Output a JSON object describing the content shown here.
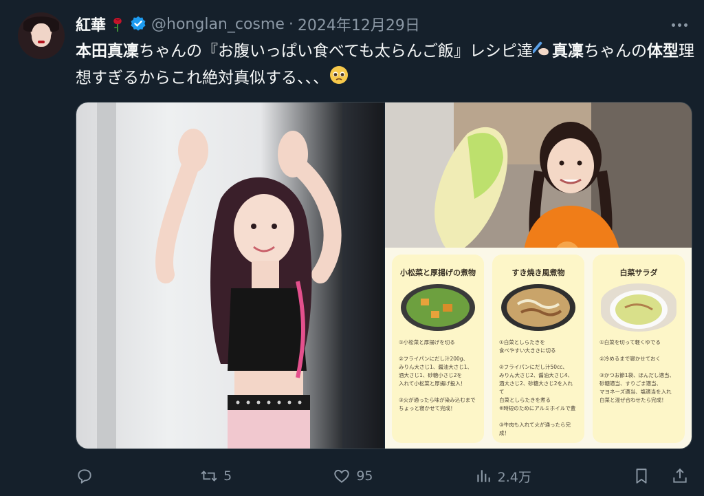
{
  "author": {
    "name": "紅華",
    "handle": "@honglan_cosme",
    "separator": "·",
    "date": "2024年12月29日"
  },
  "tweet": {
    "part1_bold": "本田真凜",
    "part2": "ちゃんの『お腹いっぱい食べても太らんご飯』レシピ達",
    "part3_bold": "真凜",
    "part4": "ちゃんの",
    "part5_bold": "体型",
    "part6": "理想すぎるからこれ絶対真似する、、、"
  },
  "recipes": [
    {
      "title": "小松菜と厚揚げの煮物",
      "steps": "①小松菜と厚揚げを切る\n\n②フライパンにだし汁200g、\nみりん大さじ1、醤油大さじ1、\n酒大さじ1、砂糖小さじ2を\n入れて小松菜と厚揚げ投入！\n\n③火が通ったら味が染み込むまで\nちょっと寝かせて完成！"
    },
    {
      "title": "すき焼き風煮物",
      "steps": "①白菜としらたきを\n食べやすい大きさに切る\n\n②フライパンにだし汁50cc、\nみりん大さじ2、醤油大さじ4、\n酒大さじ2、砂糖大さじ2を入れて\n白菜としらたきを煮る\n※時短のためにアルミホイルで蓋\n\n③牛肉も入れて火が通ったら完成！"
    },
    {
      "title": "白菜サラダ",
      "steps": "①白菜を切って軽くゆでる\n\n②冷めるまで寝かせておく\n\n③かつお節1袋、ほんだし適当、\n砂糖適当、すりごま適当、\nマヨネーズ適当、塩適当を入れ\n白菜と混ぜ合わせたら完成！"
    }
  ],
  "actions": {
    "reply_count": "",
    "retweet_count": "5",
    "like_count": "95",
    "views_count": "2.4万"
  },
  "icons": {
    "rose": "rose-icon",
    "verified": "verified-badge-icon",
    "more": "more-icon",
    "emoji_writing": "writing-hand-emoji",
    "emoji_pleading": "pleading-face-emoji",
    "reply": "reply-icon",
    "retweet": "retweet-icon",
    "like": "heart-icon",
    "views": "views-icon",
    "bookmark": "bookmark-icon",
    "share": "share-icon"
  },
  "colors": {
    "background": "#15202b",
    "text": "#f7f9f9",
    "muted": "#8b98a5",
    "verified": "#1d9bf0"
  }
}
